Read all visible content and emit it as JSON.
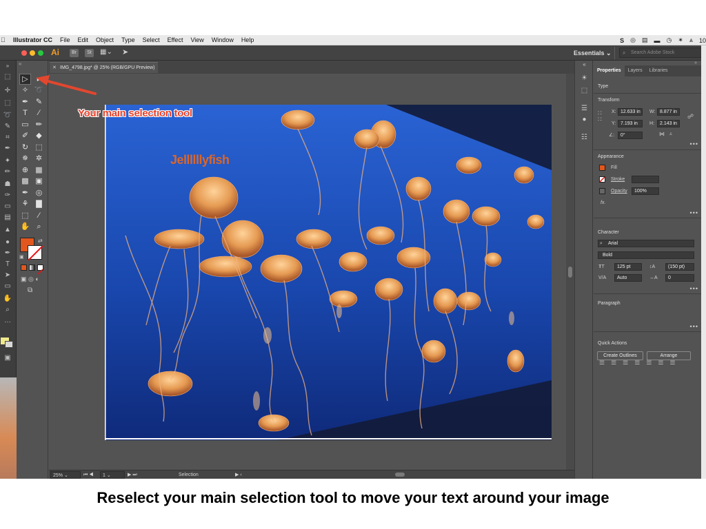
{
  "menubar": {
    "app_name": "Illustrator CC",
    "items": [
      "File",
      "Edit",
      "Object",
      "Type",
      "Select",
      "Effect",
      "View",
      "Window",
      "Help"
    ],
    "right_status": "10"
  },
  "appbar": {
    "logo": "Ai",
    "bridge": "Br",
    "stock": "St",
    "workspace": "Essentials",
    "search_placeholder": "Search Adobe Stock"
  },
  "document": {
    "tab_title": "IMG_4798.jpg* @ 25% (RGB/GPU Preview)",
    "artboard_text": "Jellllllyfish"
  },
  "statusbar": {
    "zoom": "25%",
    "artboard_number": "1",
    "mode": "Selection"
  },
  "panel": {
    "tabs": [
      "Properties",
      "Layers",
      "Libraries"
    ],
    "type_heading": "Type",
    "transform": {
      "heading": "Transform",
      "x_label": "X:",
      "x": "12.633 in",
      "y_label": "Y:",
      "y": "7.193 in",
      "w_label": "W:",
      "w": "8.877 in",
      "h_label": "H:",
      "h": "2.143 in",
      "angle": "0°"
    },
    "appearance": {
      "heading": "Appearance",
      "fill_label": "Fill",
      "stroke_label": "Stroke",
      "opacity_label": "Opacity",
      "opacity": "100%",
      "fx": "fx."
    },
    "character": {
      "heading": "Character",
      "font": "Arial",
      "style": "Bold",
      "size": "125 pt",
      "leading": "(150 pt)",
      "kerning": "Auto",
      "tracking": "0"
    },
    "paragraph_heading": "Paragraph",
    "quick_actions": {
      "heading": "Quick Actions",
      "create_outlines": "Create Outlines",
      "arrange": "Arrange"
    }
  },
  "annotations": {
    "tool_callout": "Your main selection tool",
    "caption": "Reselect your main selection tool to move your text around your image"
  },
  "colors": {
    "fill_color": "#e2571d",
    "annotation_red": "#e8402a",
    "app_dark": "#535353",
    "water_blue": "#1a4fb8"
  }
}
